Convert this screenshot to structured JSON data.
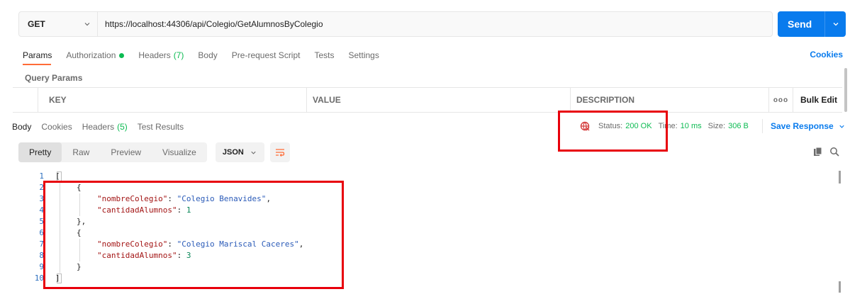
{
  "request": {
    "method": "GET",
    "url": "https://localhost:44306/api/Colegio/GetAlumnosByColegio",
    "send_label": "Send"
  },
  "request_tabs": {
    "params": "Params",
    "authorization": "Authorization",
    "headers": "Headers",
    "headers_count": "(7)",
    "body": "Body",
    "pre_request": "Pre-request Script",
    "tests": "Tests",
    "settings": "Settings",
    "cookies": "Cookies"
  },
  "query_params": {
    "label": "Query Params",
    "columns": {
      "key": "KEY",
      "value": "VALUE",
      "description": "DESCRIPTION",
      "more": "ooo",
      "bulk_edit": "Bulk Edit"
    }
  },
  "response_tabs": {
    "body": "Body",
    "cookies": "Cookies",
    "headers": "Headers",
    "headers_count": "(5)",
    "test_results": "Test Results"
  },
  "response_meta": {
    "status_label": "Status:",
    "status_value": "200 OK",
    "time_label": "Time:",
    "time_value": "10 ms",
    "size_label": "Size:",
    "size_value": "306 B",
    "save_response": "Save Response"
  },
  "format_bar": {
    "pretty": "Pretty",
    "raw": "Raw",
    "preview": "Preview",
    "visualize": "Visualize",
    "format": "JSON"
  },
  "response_body": {
    "line_numbers": [
      "1",
      "2",
      "3",
      "4",
      "5",
      "6",
      "7",
      "8",
      "9",
      "10"
    ],
    "items": [
      {
        "key1": "\"nombreColegio\"",
        "val1": "\"Colegio Benavides\"",
        "key2": "\"cantidadAlumnos\"",
        "val2": "1"
      },
      {
        "key1": "\"nombreColegio\"",
        "val1": "\"Colegio Mariscal Caceres\"",
        "key2": "\"cantidadAlumnos\"",
        "val2": "3"
      }
    ]
  },
  "colors": {
    "accent": "#097bed",
    "success": "#0cbb52",
    "tab_indicator": "#ff6c37",
    "highlight": "#e8000b"
  }
}
